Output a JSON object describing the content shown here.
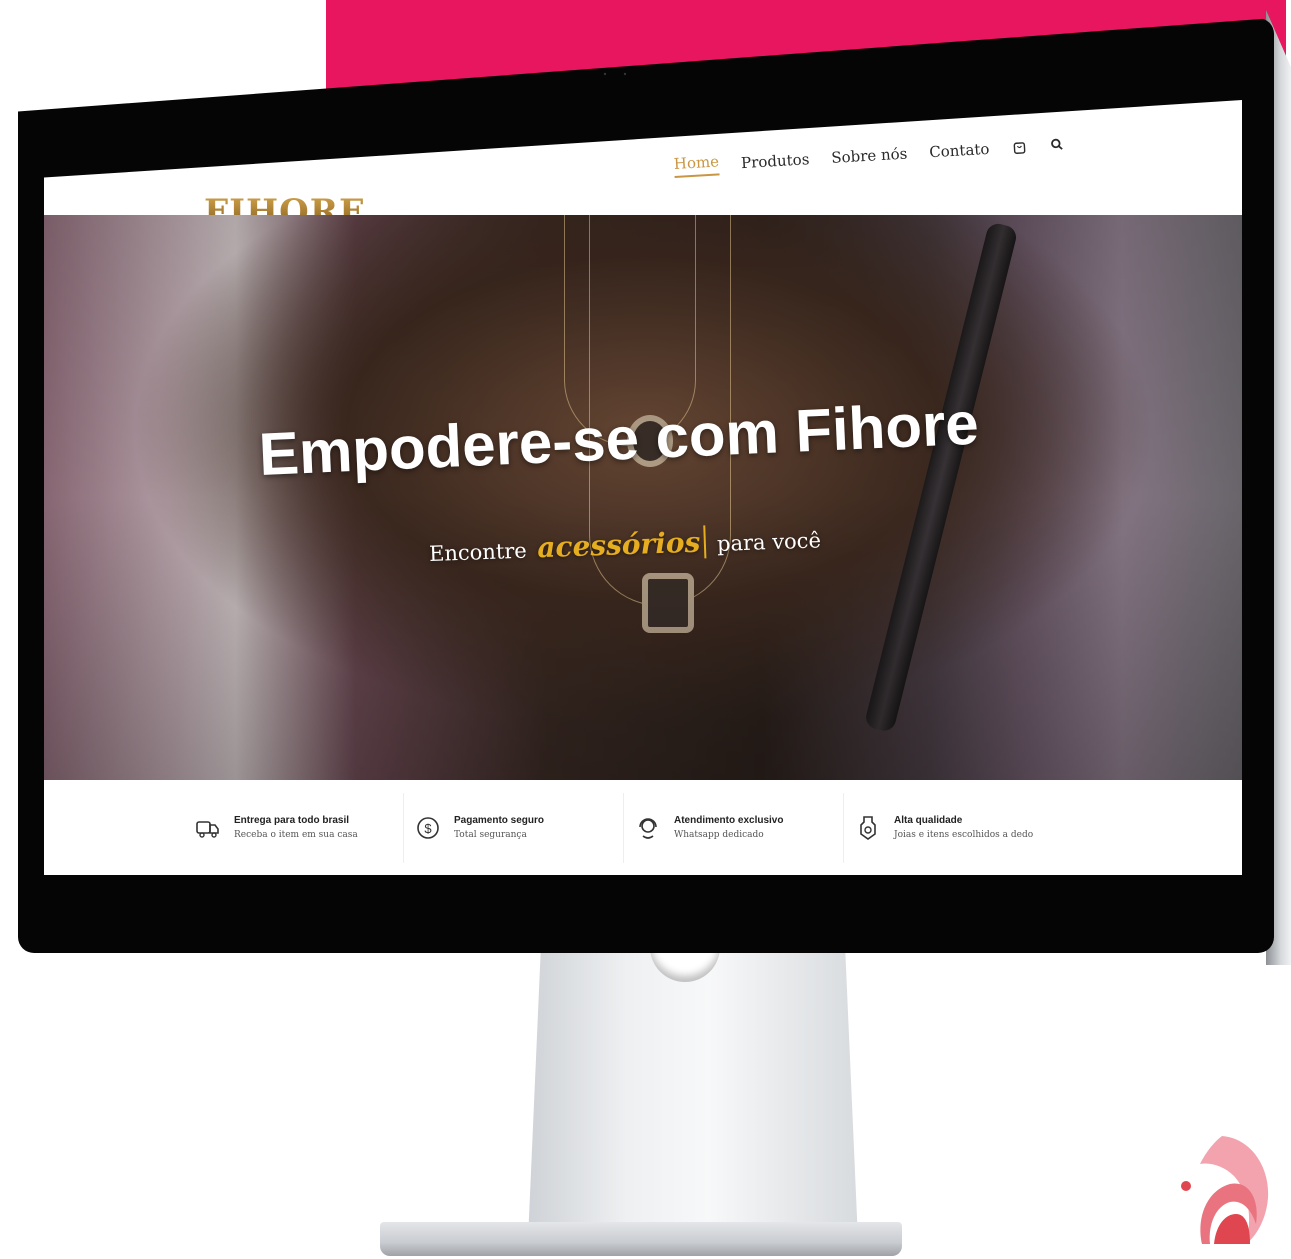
{
  "colors": {
    "accent_pink": "#e8155f",
    "gold": "#c99743",
    "highlight_yellow": "#e5ad1f"
  },
  "header": {
    "logo": "FIHORE",
    "nav": [
      {
        "label": "Home",
        "active": true
      },
      {
        "label": "Produtos",
        "active": false
      },
      {
        "label": "Sobre nós",
        "active": false
      },
      {
        "label": "Contato",
        "active": false
      }
    ],
    "icons": [
      "shopping-bag-icon",
      "search-icon"
    ]
  },
  "hero": {
    "title": "Empodere-se com Fihore",
    "subtitle_before": "Encontre",
    "subtitle_highlight": "acessórios",
    "subtitle_after": "para você"
  },
  "features": [
    {
      "icon": "truck-icon",
      "title": "Entrega para todo brasil",
      "desc": "Receba o item em sua casa"
    },
    {
      "icon": "dollar-coin-icon",
      "title": "Pagamento seguro",
      "desc": "Total segurança"
    },
    {
      "icon": "support-headset-icon",
      "title": "Atendimento exclusivo",
      "desc": "Whatsapp dedicado"
    },
    {
      "icon": "diamond-quality-icon",
      "title": "Alta qualidade",
      "desc": "Joias e itens escolhidos a dedo"
    }
  ]
}
